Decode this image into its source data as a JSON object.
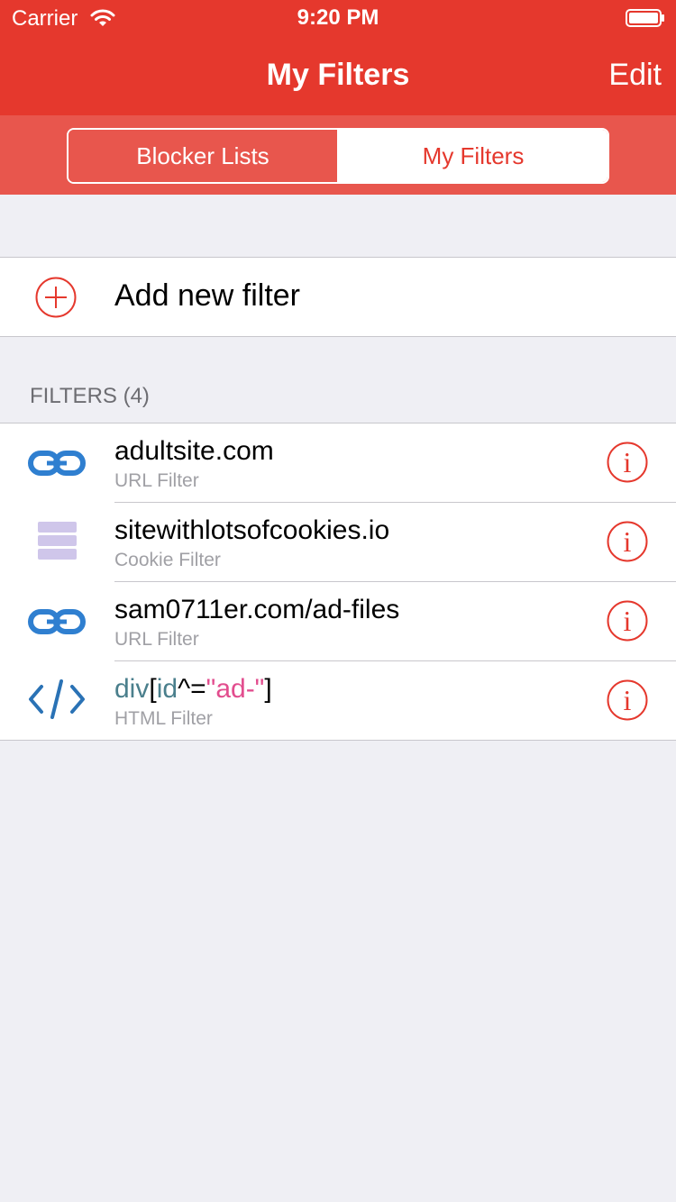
{
  "status": {
    "carrier": "Carrier",
    "time": "9:20 PM"
  },
  "nav": {
    "title": "My Filters",
    "edit_label": "Edit"
  },
  "segments": {
    "left": "Blocker Lists",
    "right": "My Filters",
    "selected": "My Filters"
  },
  "add_filter": {
    "label": "Add new filter",
    "icon": "plus-circle-icon"
  },
  "section": {
    "header": "FILTERS (4)"
  },
  "filters": [
    {
      "title": "adultsite.com",
      "subtitle": "URL Filter",
      "icon": "link-icon"
    },
    {
      "title": "sitewithlotsofcookies.io",
      "subtitle": "Cookie Filter",
      "icon": "cookie-stack-icon"
    },
    {
      "title": "sam0711er.com/ad-files",
      "subtitle": "URL Filter",
      "icon": "link-icon"
    },
    {
      "title": "div[id^=\"ad-\"]",
      "subtitle": "HTML Filter",
      "icon": "code-icon",
      "title_parts": {
        "tag": "div",
        "open": "[",
        "attr": "id",
        "op": "^=",
        "value": "\"ad-\"",
        "close": "]"
      }
    }
  ],
  "colors": {
    "accent": "#e5382d",
    "segment_bg": "#e8564d",
    "background": "#efeff4",
    "link_icon": "#2f7fd0",
    "cookie_icon": "#cfc6ea",
    "code_icon": "#2a72b5"
  }
}
